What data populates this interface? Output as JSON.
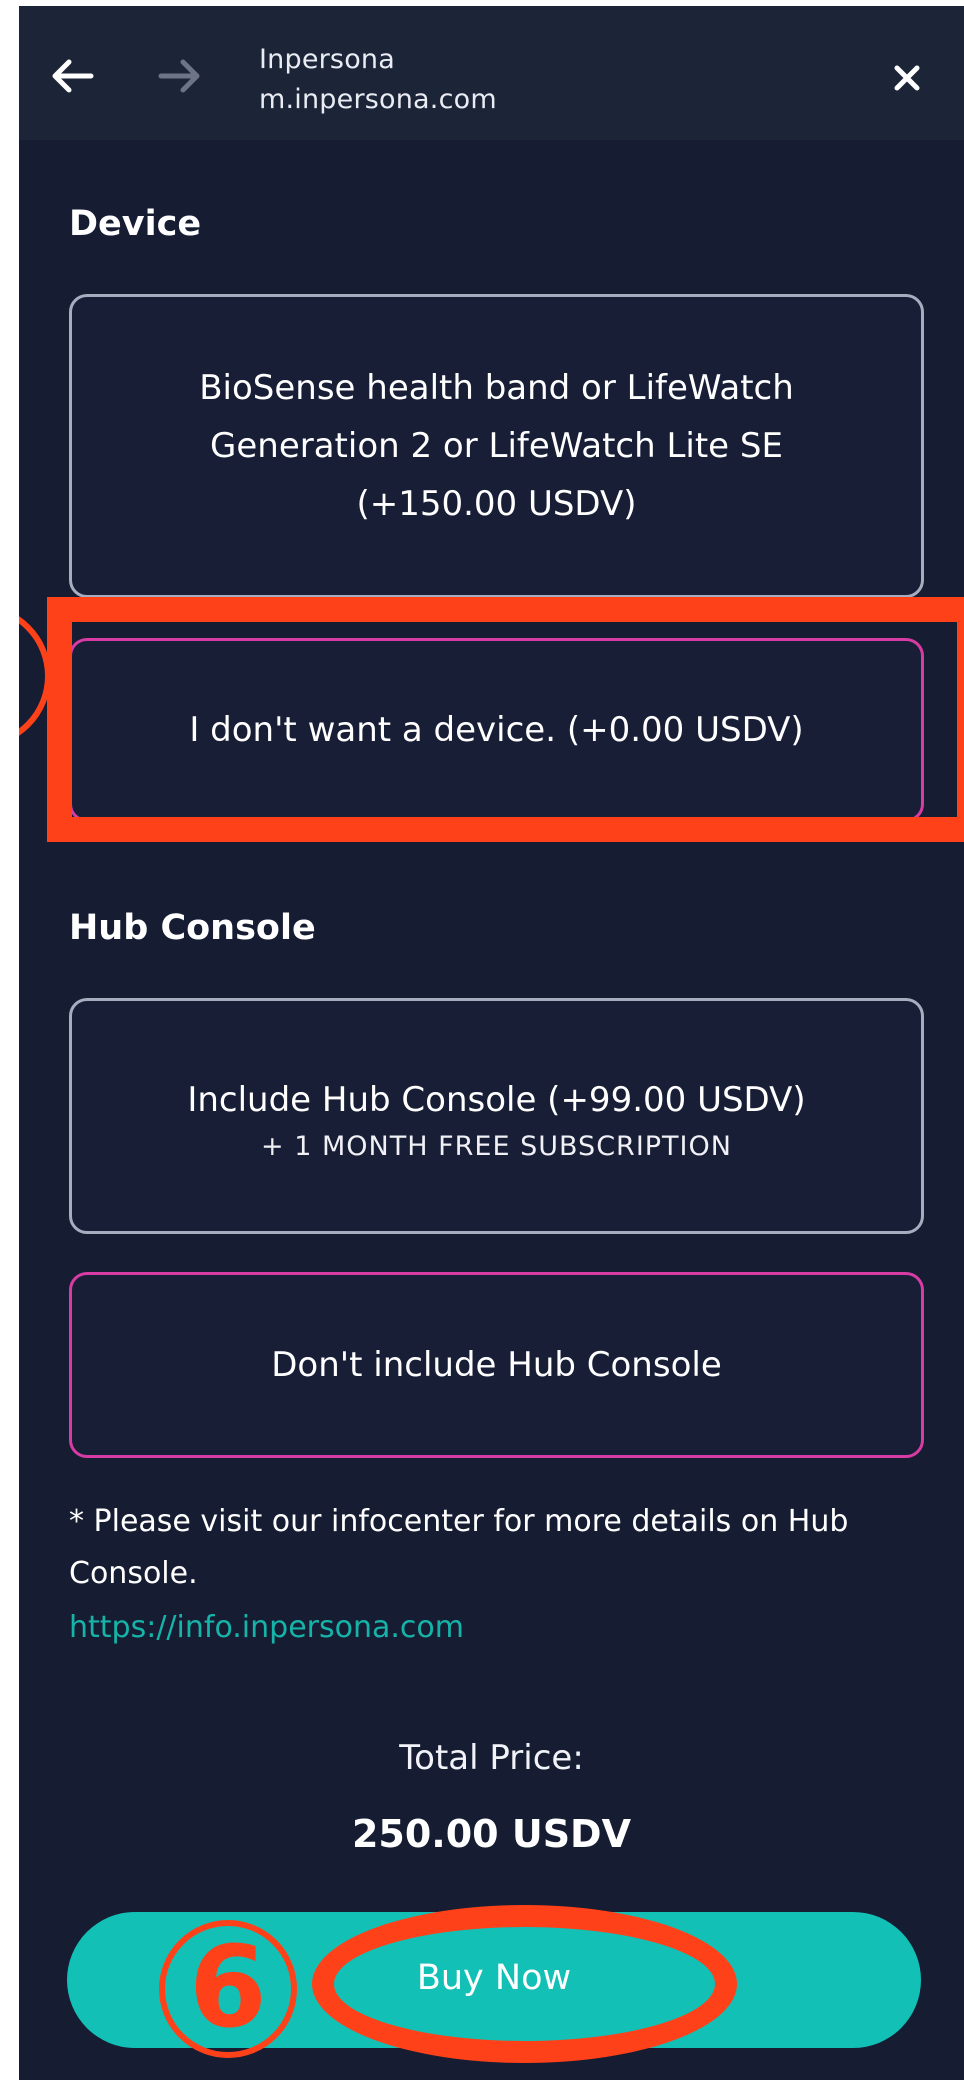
{
  "browser": {
    "site_title": "Inpersona",
    "url": "m.inpersona.com",
    "back_icon": "arrow-left-icon",
    "forward_icon": "arrow-right-icon",
    "close_icon": "close-icon"
  },
  "device_section": {
    "title": "Device",
    "options": [
      {
        "label_lines": [
          "BioSense health band or LifeWatch",
          "Generation 2 or LifeWatch Lite SE",
          "(+150.00 USDV)"
        ],
        "selected": false
      },
      {
        "label": "I don't want a device. (+0.00 USDV)",
        "selected": true
      }
    ]
  },
  "hub_section": {
    "title": "Hub Console",
    "options": [
      {
        "label": "Include Hub Console (+99.00 USDV)",
        "sub": "+ 1 MONTH FREE SUBSCRIPTION",
        "selected": false
      },
      {
        "label": "Don't include Hub Console",
        "selected": true
      }
    ]
  },
  "note": "* Please visit our infocenter for more details on Hub Console.",
  "info_link": "https://info.inpersona.com",
  "total": {
    "label": "Total Price:",
    "value": "250.00 USDV"
  },
  "buy_button": "Buy Now",
  "annotation": {
    "step_label": "6",
    "color": "#ff4119"
  },
  "colors": {
    "background": "#161d33",
    "header": "#1c2438",
    "selected_border": "#d63ca4",
    "unselected_border": "#a6adbf",
    "accent": "#12c0b6",
    "link": "#16b3a8"
  }
}
